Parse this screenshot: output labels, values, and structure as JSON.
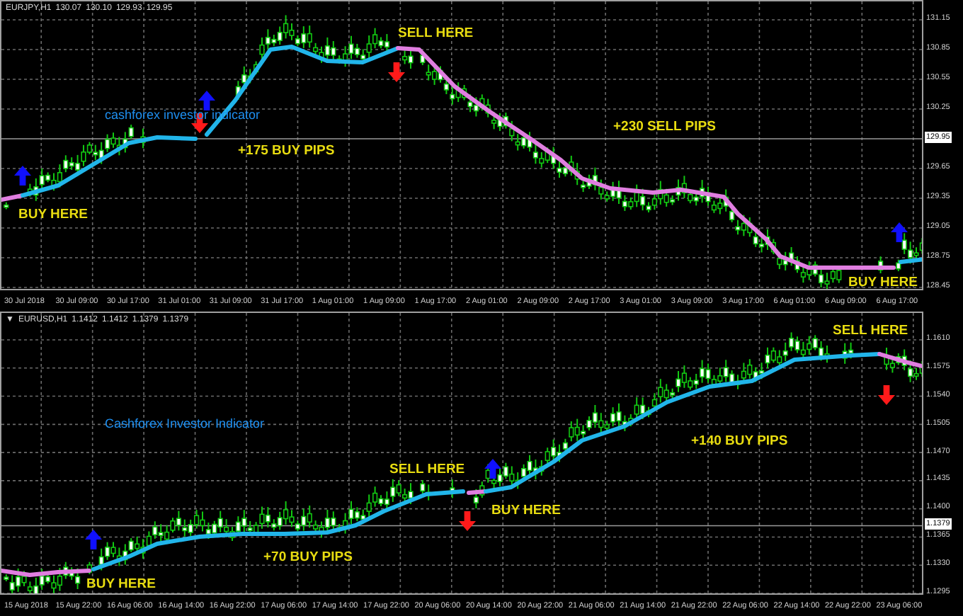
{
  "charts": [
    {
      "header": {
        "symbol": "EURJPY,H1",
        "quotes": [
          "130.07",
          "130.10",
          "129.93",
          "129.95"
        ]
      },
      "price_labels": [
        {
          "text": "131.15",
          "current": false
        },
        {
          "text": "130.85",
          "current": false
        },
        {
          "text": "130.55",
          "current": false
        },
        {
          "text": "130.25",
          "current": false
        },
        {
          "text": "129.95",
          "current": true
        },
        {
          "text": "129.65",
          "current": false
        },
        {
          "text": "129.35",
          "current": false
        },
        {
          "text": "129.05",
          "current": false
        },
        {
          "text": "128.75",
          "current": false
        },
        {
          "text": "128.45",
          "current": false
        }
      ],
      "time_labels": [
        "30 Jul 2018",
        "30 Jul 09:00",
        "30 Jul 17:00",
        "31 Jul 01:00",
        "31 Jul 09:00",
        "31 Jul 17:00",
        "1 Aug 01:00",
        "1 Aug 09:00",
        "1 Aug 17:00",
        "2 Aug 01:00",
        "2 Aug 09:00",
        "2 Aug 17:00",
        "3 Aug 01:00",
        "3 Aug 09:00",
        "3 Aug 17:00",
        "6 Aug 01:00",
        "6 Aug 09:00",
        "6 Aug 17:00"
      ],
      "annotations": [
        {
          "kind": "signal",
          "text": "SELL HERE"
        },
        {
          "kind": "caption",
          "text": "cashforex investor indicator"
        },
        {
          "kind": "pips",
          "text": "+230 SELL PIPS"
        },
        {
          "kind": "pips",
          "text": "+175 BUY PIPS"
        },
        {
          "kind": "signal",
          "text": "BUY HERE"
        },
        {
          "kind": "signal",
          "text": "BUY HERE"
        }
      ]
    },
    {
      "header": {
        "marker": "▼",
        "symbol": "EURUSD,H1",
        "quotes": [
          "1.1412",
          "1.1412",
          "1.1379",
          "1.1379"
        ]
      },
      "price_labels": [
        {
          "text": "1.1610",
          "current": false
        },
        {
          "text": "1.1575",
          "current": false
        },
        {
          "text": "1.1540",
          "current": false
        },
        {
          "text": "1.1505",
          "current": false
        },
        {
          "text": "1.1470",
          "current": false
        },
        {
          "text": "1.1435",
          "current": false
        },
        {
          "text": "1.1400",
          "current": false
        },
        {
          "text": "1.1379",
          "current": true
        },
        {
          "text": "1.1365",
          "current": false
        },
        {
          "text": "1.1330",
          "current": false
        },
        {
          "text": "1.1295",
          "current": false
        }
      ],
      "time_labels": [
        "15 Aug 2018",
        "15 Aug 22:00",
        "16 Aug 06:00",
        "16 Aug 14:00",
        "16 Aug 22:00",
        "17 Aug 06:00",
        "17 Aug 14:00",
        "17 Aug 22:00",
        "20 Aug 06:00",
        "20 Aug 14:00",
        "20 Aug 22:00",
        "21 Aug 06:00",
        "21 Aug 14:00",
        "21 Aug 22:00",
        "22 Aug 06:00",
        "22 Aug 14:00",
        "22 Aug 22:00",
        "23 Aug 06:00"
      ],
      "annotations": [
        {
          "kind": "signal",
          "text": "SELL HERE"
        },
        {
          "kind": "caption",
          "text": "Cashforex Investor Indicator"
        },
        {
          "kind": "pips",
          "text": "+140 BUY PIPS"
        },
        {
          "kind": "signal",
          "text": "SELL HERE"
        },
        {
          "kind": "signal",
          "text": "BUY HERE"
        },
        {
          "kind": "pips",
          "text": "+70 BUY PIPS"
        },
        {
          "kind": "signal",
          "text": "BUY HERE"
        }
      ]
    }
  ]
}
